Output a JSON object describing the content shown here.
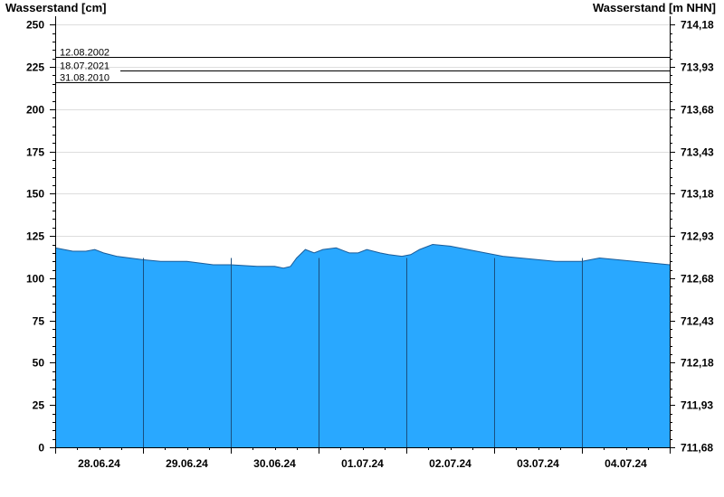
{
  "chart_data": {
    "type": "area",
    "ylabel": "Wasserstand [cm]",
    "ylabel_right": "Wasserstand [m NHN]",
    "ylim": [
      0,
      255
    ],
    "yticks": [
      0,
      25,
      50,
      75,
      100,
      125,
      150,
      175,
      200,
      225,
      250
    ],
    "yticks_right": [
      "711,68",
      "711,93",
      "712,18",
      "712,43",
      "712,68",
      "712,93",
      "713,18",
      "713,43",
      "713,68",
      "713,93",
      "714,18"
    ],
    "xlim_days": [
      0,
      7
    ],
    "xticks": [
      "28.06.24",
      "29.06.24",
      "30.06.24",
      "01.07.24",
      "02.07.24",
      "03.07.24",
      "04.07.24"
    ],
    "grid": true,
    "fill_color": "#29a8ff",
    "reference_levels": [
      {
        "label": "12.08.2002",
        "value": 231
      },
      {
        "label": "18.07.2021",
        "value": 223
      },
      {
        "label": "31.08.2010",
        "value": 216
      }
    ],
    "series": [
      {
        "x": [
          0.0,
          0.1,
          0.2,
          0.35,
          0.45,
          0.55,
          0.7,
          0.85,
          1.0,
          1.2,
          1.5,
          1.8,
          2.0,
          2.3,
          2.5,
          2.6,
          2.68,
          2.75,
          2.85,
          2.95,
          3.05,
          3.2,
          3.35,
          3.45,
          3.55,
          3.7,
          3.8,
          3.95,
          4.05,
          4.15,
          4.3,
          4.5,
          4.7,
          4.9,
          5.1,
          5.3,
          5.5,
          5.7,
          5.85,
          6.0,
          6.2,
          6.4,
          6.6,
          6.8,
          7.0
        ],
        "y": [
          118,
          117,
          116,
          116,
          117,
          115,
          113,
          112,
          111,
          110,
          110,
          108,
          108,
          107,
          107,
          106,
          107,
          112,
          117,
          115,
          117,
          118,
          115,
          115,
          117,
          115,
          114,
          113,
          114,
          117,
          120,
          119,
          117,
          115,
          113,
          112,
          111,
          110,
          110,
          110,
          112,
          111,
          110,
          109,
          108
        ]
      }
    ]
  }
}
